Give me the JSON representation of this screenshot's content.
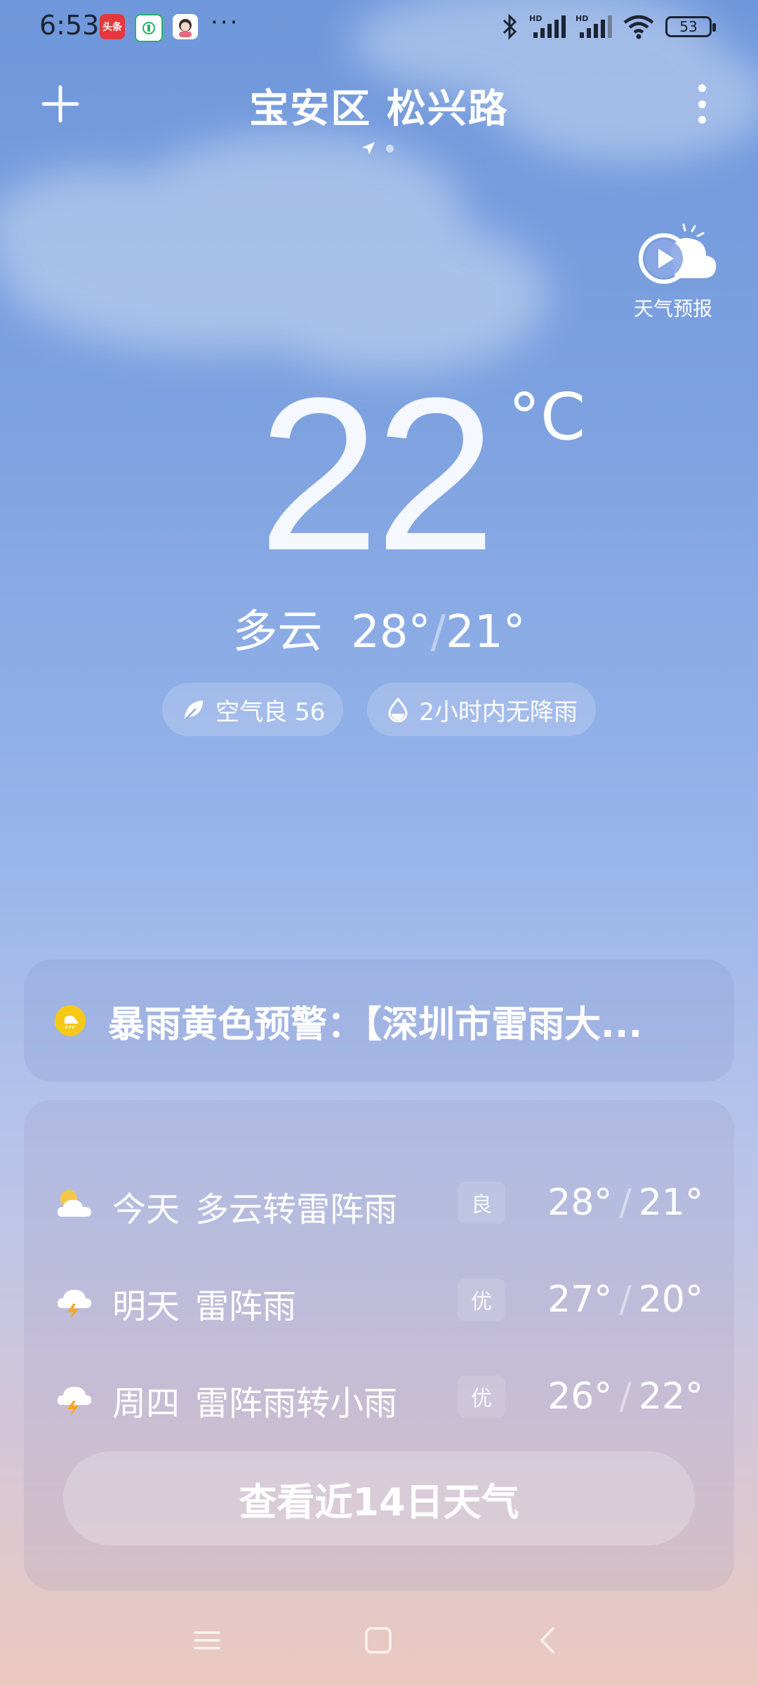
{
  "status_bar": {
    "time": "6:53",
    "badges": [
      "头条"
    ],
    "more": "···",
    "battery": "53"
  },
  "header": {
    "location": "宝安区 松兴路",
    "menu_icon": "more-vert-icon",
    "add_icon": "plus-icon"
  },
  "forecast_video": {
    "label": "天气预报"
  },
  "current": {
    "temperature": "22",
    "unit": "°C",
    "condition": "多云",
    "high": "28°",
    "low": "21°"
  },
  "chips": {
    "air_quality": "空气良 56",
    "precipitation": "2小时内无降雨"
  },
  "alert": {
    "text": "暴雨黄色预警：【深圳市雷雨大..."
  },
  "forecast": [
    {
      "day": "今天",
      "condition": "多云转雷阵雨",
      "aqi": "良",
      "high": "28°",
      "low": "21°",
      "icon": "partly-cloudy-icon"
    },
    {
      "day": "明天",
      "condition": "雷阵雨",
      "aqi": "优",
      "high": "27°",
      "low": "20°",
      "icon": "thunderstorm-icon"
    },
    {
      "day": "周四",
      "condition": "雷阵雨转小雨",
      "aqi": "优",
      "high": "26°",
      "low": "22°",
      "icon": "thunderstorm-icon"
    }
  ],
  "more_button": "查看近14日天气",
  "colors": {
    "alert_yellow": "#f6c818",
    "sun_yellow": "#f7c847",
    "bolt_orange": "#f5a623"
  }
}
